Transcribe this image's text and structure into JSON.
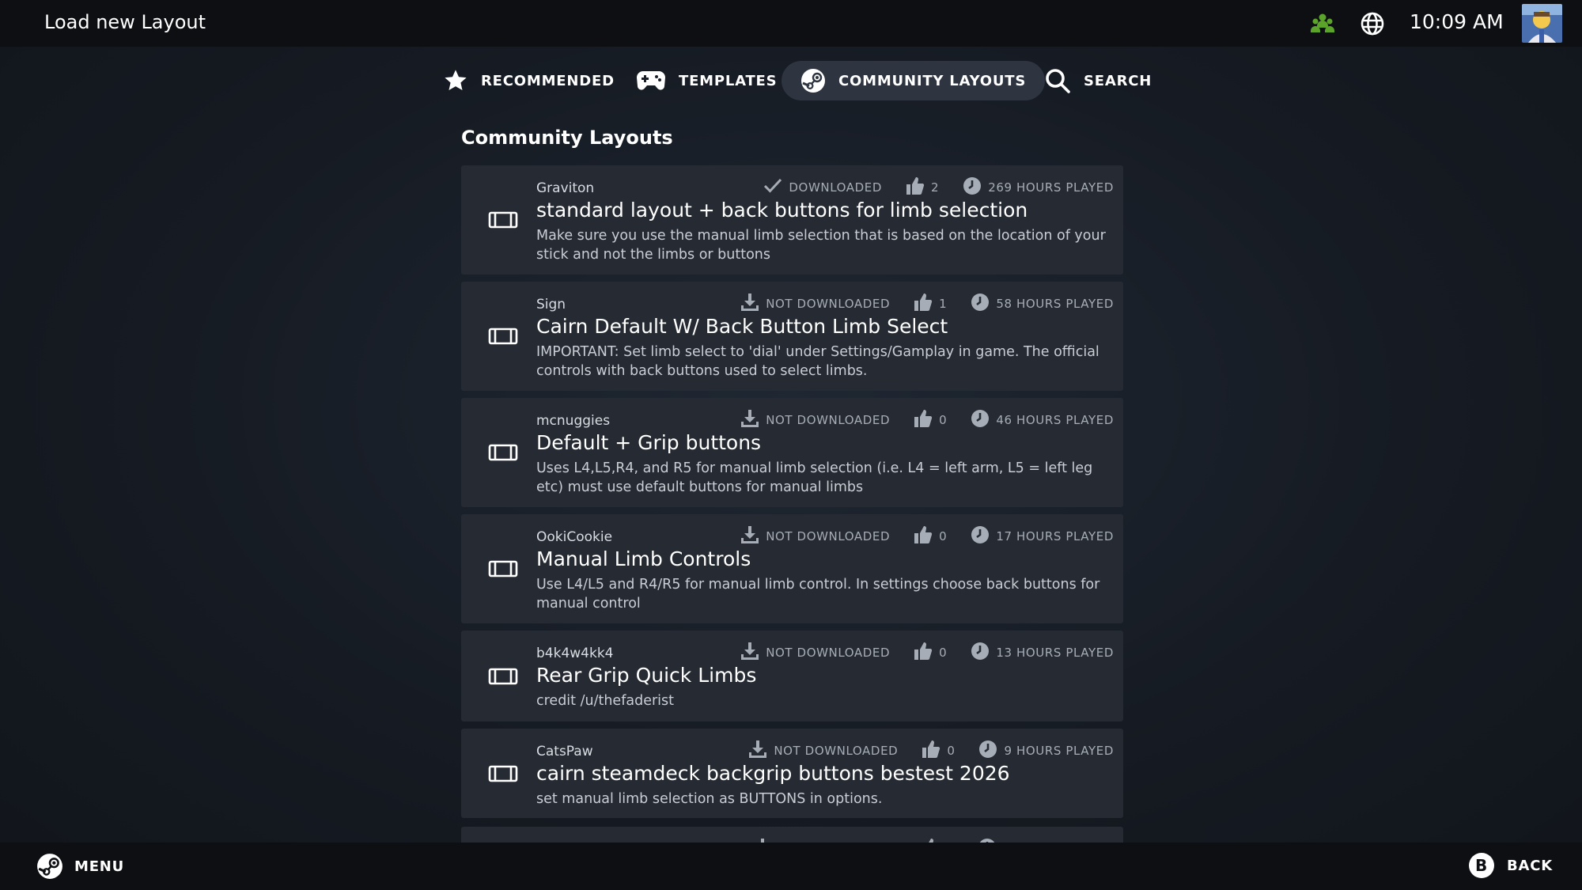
{
  "header": {
    "title": "Load new Layout",
    "time": "10:09 AM",
    "icons": [
      "friends-icon",
      "globe-icon",
      "avatar"
    ]
  },
  "tabs": [
    {
      "label": "RECOMMENDED",
      "icon": "star-icon",
      "active": false
    },
    {
      "label": "TEMPLATES",
      "icon": "gamepad-icon",
      "active": false
    },
    {
      "label": "COMMUNITY LAYOUTS",
      "icon": "steam-icon",
      "active": true
    },
    {
      "label": "SEARCH",
      "icon": "search-icon",
      "active": false
    }
  ],
  "section_title": "Community Layouts",
  "layouts": [
    {
      "author": "Graviton",
      "name": "standard layout + back buttons for limb selection",
      "description": "Make sure you use the manual limb selection that is based on the location of your stick and not the limbs or buttons",
      "status": "DOWNLOADED",
      "likes": "2",
      "hours": "269 HOURS PLAYED"
    },
    {
      "author": "Sign",
      "name": "Cairn Default W/ Back Button Limb Select",
      "description": "IMPORTANT: Set limb select to 'dial' under Settings/Gamplay in game. The official controls with back buttons used to select limbs.",
      "status": "NOT DOWNLOADED",
      "likes": "1",
      "hours": "58 HOURS PLAYED"
    },
    {
      "author": "mcnuggies",
      "name": "Default + Grip buttons",
      "description": "Uses L4,L5,R4, and R5 for manual limb selection (i.e. L4 = left arm, L5 = left leg etc) must use default buttons for manual limbs",
      "status": "NOT DOWNLOADED",
      "likes": "0",
      "hours": "46 HOURS PLAYED"
    },
    {
      "author": "OokiCookie",
      "name": "Manual Limb Controls",
      "description": "Use L4/L5 and R4/R5 for manual limb control. In settings choose back buttons for manual control",
      "status": "NOT DOWNLOADED",
      "likes": "0",
      "hours": "17 HOURS PLAYED"
    },
    {
      "author": "b4k4w4kk4",
      "name": "Rear Grip Quick Limbs",
      "description": "credit /u/thefaderist",
      "status": "NOT DOWNLOADED",
      "likes": "0",
      "hours": "13 HOURS PLAYED"
    },
    {
      "author": "CatsPaw",
      "name": "cairn steamdeck backgrip buttons bestest 2026",
      "description": "set manual limb selection as BUTTONS in options.",
      "status": "NOT DOWNLOADED",
      "likes": "0",
      "hours": "9 HOURS PLAYED"
    }
  ],
  "footer": {
    "menu_label": "MENU",
    "back_button_glyph": "B",
    "back_label": "BACK"
  },
  "colors": {
    "accent_green": "#5ba32b",
    "card_bg": "#262b33",
    "active_tab_bg": "#2e3540",
    "bar_bg": "#0d0f13"
  }
}
